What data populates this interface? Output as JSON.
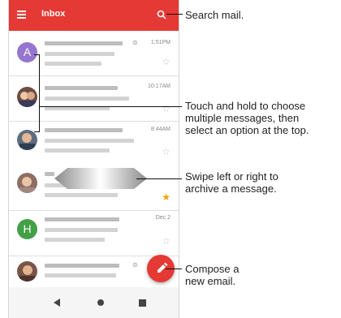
{
  "app": {
    "title": "Inbox",
    "icons": {
      "menu": "menu-icon",
      "search": "search-icon",
      "compose": "pencil-icon"
    }
  },
  "messages": [
    {
      "avatar_type": "letter",
      "letter": "A",
      "avatar_color": "#9575cd",
      "time": "1:51PM",
      "starred": false,
      "attachment": true
    },
    {
      "avatar_type": "photo",
      "avatar_color": "#6d4c41",
      "time": "10:17AM",
      "starred": false,
      "attachment": false
    },
    {
      "avatar_type": "photo",
      "avatar_color": "#5d6d7e",
      "time": "8:44AM",
      "starred": false,
      "attachment": false
    },
    {
      "avatar_type": "photo",
      "avatar_color": "#8d6e63",
      "time": "",
      "starred": true,
      "attachment": false,
      "swiping": true
    },
    {
      "avatar_type": "letter",
      "letter": "H",
      "avatar_color": "#43a047",
      "time": "Dec 2",
      "starred": false,
      "attachment": false
    },
    {
      "avatar_type": "photo",
      "avatar_color": "#795548",
      "time": "",
      "starred": false,
      "attachment": true
    }
  ],
  "callouts": {
    "search": "Search mail.",
    "select_line1": "Touch and hold to choose",
    "select_line2": "multiple messages, then",
    "select_line3": "select an option at the top.",
    "swipe_line1": "Swipe left or right to",
    "swipe_line2": "archive a message.",
    "compose_line1": "Compose a",
    "compose_line2": "new email."
  },
  "navbar": {
    "back": "back-triangle-icon",
    "home": "home-circle-icon",
    "recents": "recents-square-icon"
  },
  "colors": {
    "accent": "#e53935",
    "star_on": "#f4a300"
  }
}
